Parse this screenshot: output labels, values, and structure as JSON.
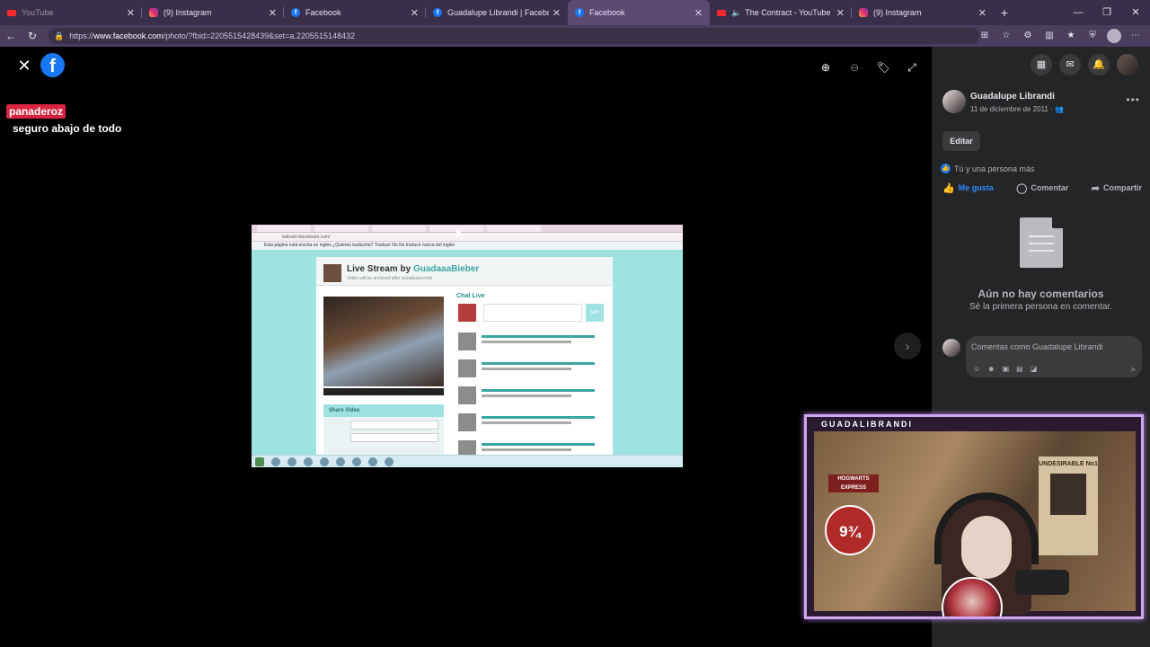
{
  "browser": {
    "tabs": [
      {
        "title": "YouTube",
        "favicon": "youtube",
        "active": false,
        "dim": true
      },
      {
        "title": "(9) Instagram",
        "favicon": "instagram",
        "active": false
      },
      {
        "title": "Facebook",
        "favicon": "facebook",
        "active": false
      },
      {
        "title": "Guadalupe Librandi | Facebook",
        "favicon": "facebook",
        "active": false
      },
      {
        "title": "Facebook",
        "favicon": "facebook",
        "active": true
      },
      {
        "title": "The Contract - YouTube",
        "favicon": "youtube",
        "active": false,
        "audio": true
      },
      {
        "title": "(9) Instagram",
        "favicon": "instagram",
        "active": false
      }
    ],
    "url_prefix": "https://",
    "url_host": "www.facebook.com",
    "url_path": "/photo/?fbid=2205515428439&set=a.2205515148432"
  },
  "viewer": {
    "overlay_username": "panaderoz",
    "overlay_message": "seguro abajo de todo",
    "photo": {
      "stream_title": "Live Stream by",
      "stream_user": "GuadaaaBieber",
      "stream_subtitle": "Video will be archived after broadcast ends",
      "chat_title": "Chat Live",
      "say_label": "SAY",
      "share_title": "Share Video",
      "url_text": "twitcam.livestream.com/",
      "translate_text": "Esta página está escrita en inglés ¿Quieres traducirla? Traducir No No traducir nunca del inglés"
    }
  },
  "panel": {
    "author_name": "Guadalupe Librandi",
    "date": "11 de diciembre de 2011 ·",
    "edit_label": "Editar",
    "likes_text": "Tú y una persona más",
    "actions": {
      "like": "Me gusta",
      "comment": "Comentar",
      "share": "Compartir"
    },
    "no_comments_title": "Aún no hay comentarios",
    "no_comments_sub": "Sé la primera persona en comentar.",
    "comment_placeholder": "Comentas como Guadalupe Librandi"
  },
  "webcam": {
    "label": "GUADALIBRANDI",
    "sign_platform": "9¾",
    "sign_hogwarts": "HOGWARTS EXPRESS",
    "poster_text": "UNDESIRABLE No1"
  },
  "colors": {
    "facebook_blue": "#1877f2",
    "panel_bg": "#242526",
    "like_active": "#2d88ff",
    "webcam_frame": "#cda8f0",
    "overlay_badge": "#d9243f"
  }
}
